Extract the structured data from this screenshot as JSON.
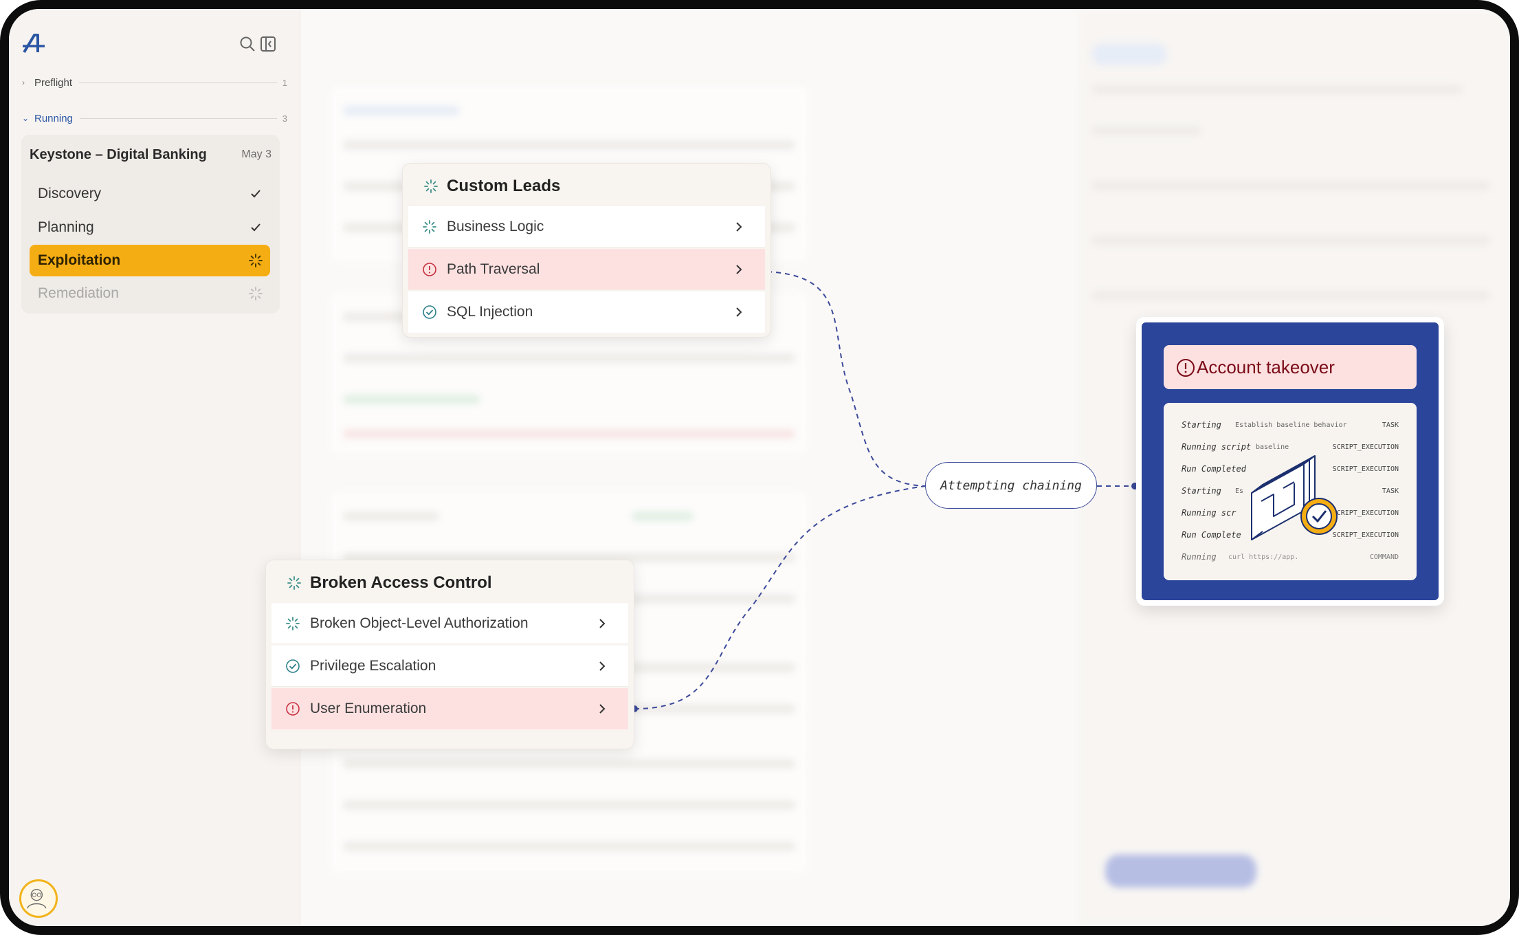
{
  "sidebar": {
    "sections": [
      {
        "label": "Preflight",
        "count": "1"
      },
      {
        "label": "Running",
        "count": "3"
      }
    ],
    "project": {
      "title": "Keystone – Digital Banking",
      "date": "May 3",
      "steps": [
        {
          "label": "Discovery",
          "status": "done"
        },
        {
          "label": "Planning",
          "status": "done"
        },
        {
          "label": "Exploitation",
          "status": "active"
        },
        {
          "label": "Remediation",
          "status": "pending"
        }
      ]
    },
    "colors": {
      "accent": "#f5ad14",
      "running": "#2b56a3"
    }
  },
  "custom_leads": {
    "title": "Custom Leads",
    "items": [
      {
        "label": "Business Logic",
        "status": "running"
      },
      {
        "label": "Path Traversal",
        "status": "alert"
      },
      {
        "label": "SQL Injection",
        "status": "done"
      }
    ]
  },
  "broken_access": {
    "title": "Broken Access Control",
    "items": [
      {
        "label": "Broken Object-Level Authorization",
        "status": "running"
      },
      {
        "label": "Privilege Escalation",
        "status": "done"
      },
      {
        "label": "User Enumeration",
        "status": "alert"
      }
    ]
  },
  "chain": {
    "label": "Attempting chaining"
  },
  "takeover": {
    "title": "Account takeover",
    "log": [
      {
        "state": "Starting",
        "desc": "Establish baseline behavior",
        "type": "TASK"
      },
      {
        "state": "Running script",
        "desc": "baseline",
        "type": "SCRIPT_EXECUTION"
      },
      {
        "state": "Run Completed",
        "desc": "",
        "type": "SCRIPT_EXECUTION"
      },
      {
        "state": "Starting",
        "desc": "Es",
        "type": "TASK"
      },
      {
        "state": "Running scr",
        "desc": "",
        "type": "SCRIPT_EXECUTION"
      },
      {
        "state": "Run Complete",
        "desc": "",
        "type": "SCRIPT_EXECUTION"
      },
      {
        "state": "Running",
        "desc": "curl https://app.",
        "type": "COMMAND"
      }
    ],
    "colors": {
      "panel": "#2b459a",
      "alert": "#7a0a16"
    }
  }
}
